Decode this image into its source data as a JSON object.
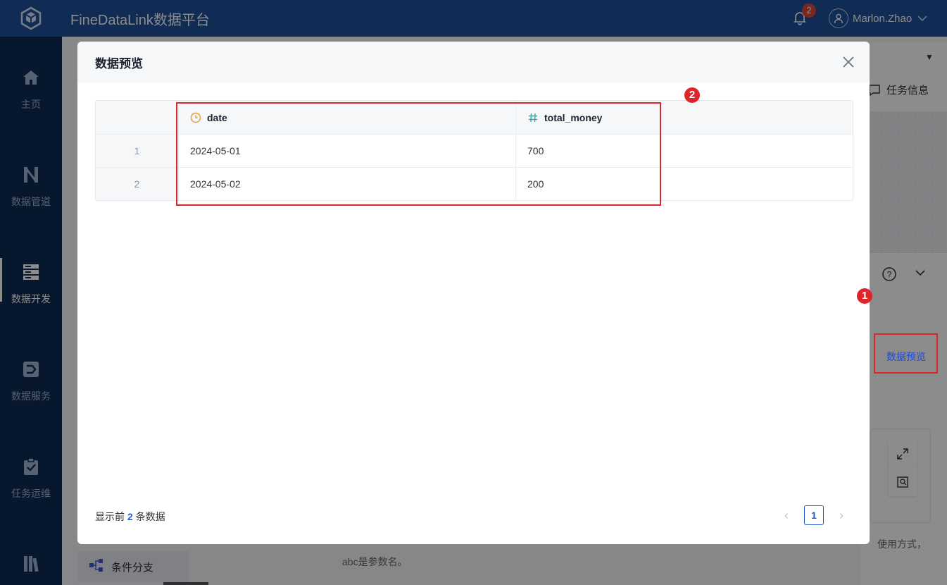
{
  "app": {
    "title": "FineDataLink数据平台"
  },
  "notifications": {
    "count": "2"
  },
  "user": {
    "name": "Marlon.Zhao"
  },
  "sidebar": {
    "items": [
      {
        "label": "主页",
        "icon": "home-icon"
      },
      {
        "label": "数据管道",
        "icon": "pipeline-icon"
      },
      {
        "label": "数据开发",
        "icon": "dev-icon",
        "active": true
      },
      {
        "label": "数据服务",
        "icon": "service-icon"
      },
      {
        "label": "任务运维",
        "icon": "ops-icon"
      }
    ]
  },
  "background": {
    "task_info": "任务信息",
    "preview_link": "数据预览",
    "condition_branch": "条件分支",
    "description": "abc是参数名。",
    "description_tail": "使用方式，"
  },
  "markers": {
    "one": "1",
    "two": "2"
  },
  "modal": {
    "title": "数据预览",
    "table": {
      "columns": [
        {
          "name": "date",
          "type_icon": "clock-icon"
        },
        {
          "name": "total_money",
          "type_icon": "hash-icon"
        }
      ],
      "rows": [
        {
          "index": "1",
          "date": "2024-05-01",
          "total_money": "700"
        },
        {
          "index": "2",
          "date": "2024-05-02",
          "total_money": "200"
        }
      ]
    },
    "footer": {
      "prefix": "显示前",
      "count": "2",
      "suffix": "条数据"
    },
    "pagination": {
      "current_page": "1"
    }
  },
  "colors": {
    "brand": "#1e4f99",
    "sidebar": "#0d2a52",
    "accent": "#1e5fd8",
    "highlight": "#e0242b"
  }
}
